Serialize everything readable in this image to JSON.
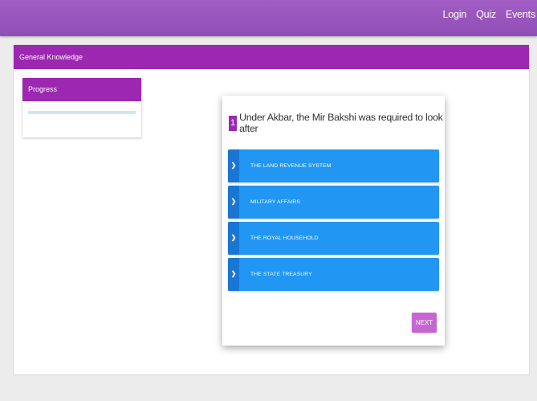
{
  "nav": {
    "items": [
      "Login",
      "Quiz",
      "Events"
    ]
  },
  "panel": {
    "title": "General Knowledge"
  },
  "progress": {
    "title": "Progress",
    "value": 0
  },
  "question": {
    "number": "1",
    "text": "Under Akbar, the Mir Bakshi was required to look after"
  },
  "options": [
    {
      "icon": "chevron-right-icon",
      "label": "THE LAND REVENUE SYSTEM"
    },
    {
      "icon": "chevron-right-icon",
      "label": "MILITARY AFFAIRS"
    },
    {
      "icon": "chevron-right-icon",
      "label": "THE ROYAL HOUSEHOLD"
    },
    {
      "icon": "chevron-right-icon",
      "label": "THE STATE TREASURY"
    }
  ],
  "next_label": "NEXT",
  "colors": {
    "topbar": "#9b59c0",
    "header": "#9c27b0",
    "option": "#2196f3",
    "option_tab": "#1976d2",
    "next": "#c566d2"
  }
}
